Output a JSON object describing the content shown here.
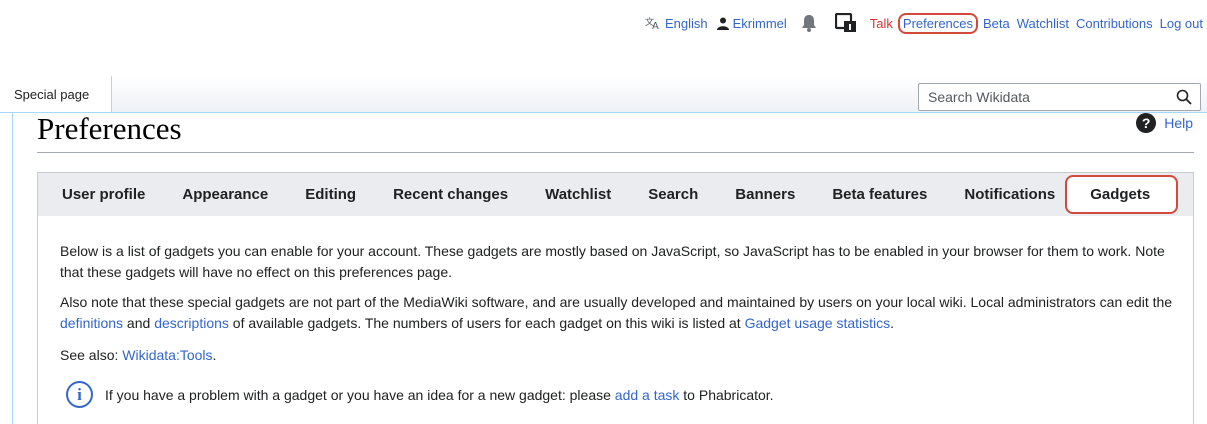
{
  "personal": {
    "language": "English",
    "username": "Ekrimmel",
    "talk": "Talk",
    "preferences": "Preferences",
    "beta": "Beta",
    "watchlist": "Watchlist",
    "contributions": "Contributions",
    "logout": "Log out"
  },
  "header": {
    "special_tab": "Special page",
    "search_placeholder": "Search Wikidata"
  },
  "page": {
    "title": "Preferences",
    "help": "Help"
  },
  "tabs": [
    {
      "label": "User profile"
    },
    {
      "label": "Appearance"
    },
    {
      "label": "Editing"
    },
    {
      "label": "Recent changes"
    },
    {
      "label": "Watchlist"
    },
    {
      "label": "Search"
    },
    {
      "label": "Banners"
    },
    {
      "label": "Beta features"
    },
    {
      "label": "Notifications"
    },
    {
      "label": "Gadgets",
      "active": true
    }
  ],
  "content": {
    "p1": "Below is a list of gadgets you can enable for your account. These gadgets are mostly based on JavaScript, so JavaScript has to be enabled in your browser for them to work. Note that these gadgets will have no effect on this preferences page.",
    "p2_a": "Also note that these special gadgets are not part of the MediaWiki software, and are usually developed and maintained by users on your local wiki. Local administrators can edit the ",
    "p2_link1": "definitions",
    "p2_b": " and ",
    "p2_link2": "descriptions",
    "p2_c": " of available gadgets. The numbers of users for each gadget on this wiki is listed at ",
    "p2_link3": "Gadget usage statistics",
    "p2_d": ".",
    "p3_a": "See also: ",
    "p3_link": "Wikidata:Tools",
    "p3_b": ".",
    "notice_a": "If you have a problem with a gadget or you have an idea for a new gadget: please ",
    "notice_link": "add a task",
    "notice_b": " to Phabricator."
  },
  "colors": {
    "link": "#3366cc",
    "talk": "#dd3333",
    "highlight": "#d24a3c"
  }
}
